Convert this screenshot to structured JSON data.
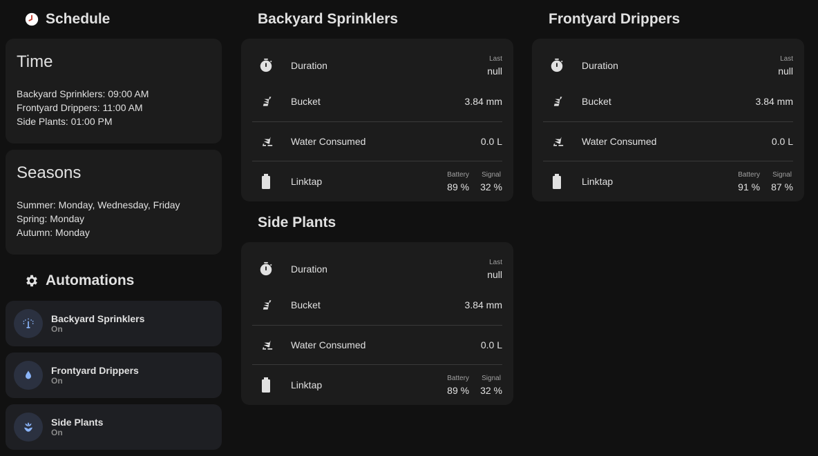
{
  "left": {
    "schedule_heading": "Schedule",
    "time_card": {
      "title": "Time",
      "lines": [
        "Backyard Sprinklers: 09:00 AM",
        "Frontyard Drippers: 11:00 AM",
        "Side Plants: 01:00 PM"
      ]
    },
    "seasons_card": {
      "title": "Seasons",
      "lines": [
        "Summer: Monday, Wednesday, Friday",
        "Spring: Monday",
        "Autumn: Monday"
      ]
    },
    "automations_heading": "Automations",
    "automations": [
      {
        "name": "Backyard Sprinklers",
        "state": "On",
        "icon": "sprinkler-icon"
      },
      {
        "name": "Frontyard Drippers",
        "state": "On",
        "icon": "water-drop-icon"
      },
      {
        "name": "Side Plants",
        "state": "On",
        "icon": "flower-icon"
      }
    ]
  },
  "zones": [
    {
      "title": "Backyard Sprinklers",
      "duration_label": "Duration",
      "last_label": "Last",
      "duration_value": "null",
      "bucket_label": "Bucket",
      "bucket_value": "3.84 mm",
      "water_label": "Water Consumed",
      "water_value": "0.0 L",
      "linktap_label": "Linktap",
      "battery_label": "Battery",
      "battery_value": "89 %",
      "signal_label": "Signal",
      "signal_value": "32 %"
    },
    {
      "title": "Side Plants",
      "duration_label": "Duration",
      "last_label": "Last",
      "duration_value": "null",
      "bucket_label": "Bucket",
      "bucket_value": "3.84 mm",
      "water_label": "Water Consumed",
      "water_value": "0.0 L",
      "linktap_label": "Linktap",
      "battery_label": "Battery",
      "battery_value": "89 %",
      "signal_label": "Signal",
      "signal_value": "32 %"
    },
    {
      "title": "Frontyard Drippers",
      "duration_label": "Duration",
      "last_label": "Last",
      "duration_value": "null",
      "bucket_label": "Bucket",
      "bucket_value": "3.84 mm",
      "water_label": "Water Consumed",
      "water_value": "0.0 L",
      "linktap_label": "Linktap",
      "battery_label": "Battery",
      "battery_value": "91 %",
      "signal_label": "Signal",
      "signal_value": "87 %"
    }
  ],
  "colors": {
    "background": "#111111",
    "card": "#1c1c1c",
    "tile": "#1e1f23",
    "tile_icon_bg": "#2b3140",
    "accent_icon": "#8ab4f8"
  }
}
